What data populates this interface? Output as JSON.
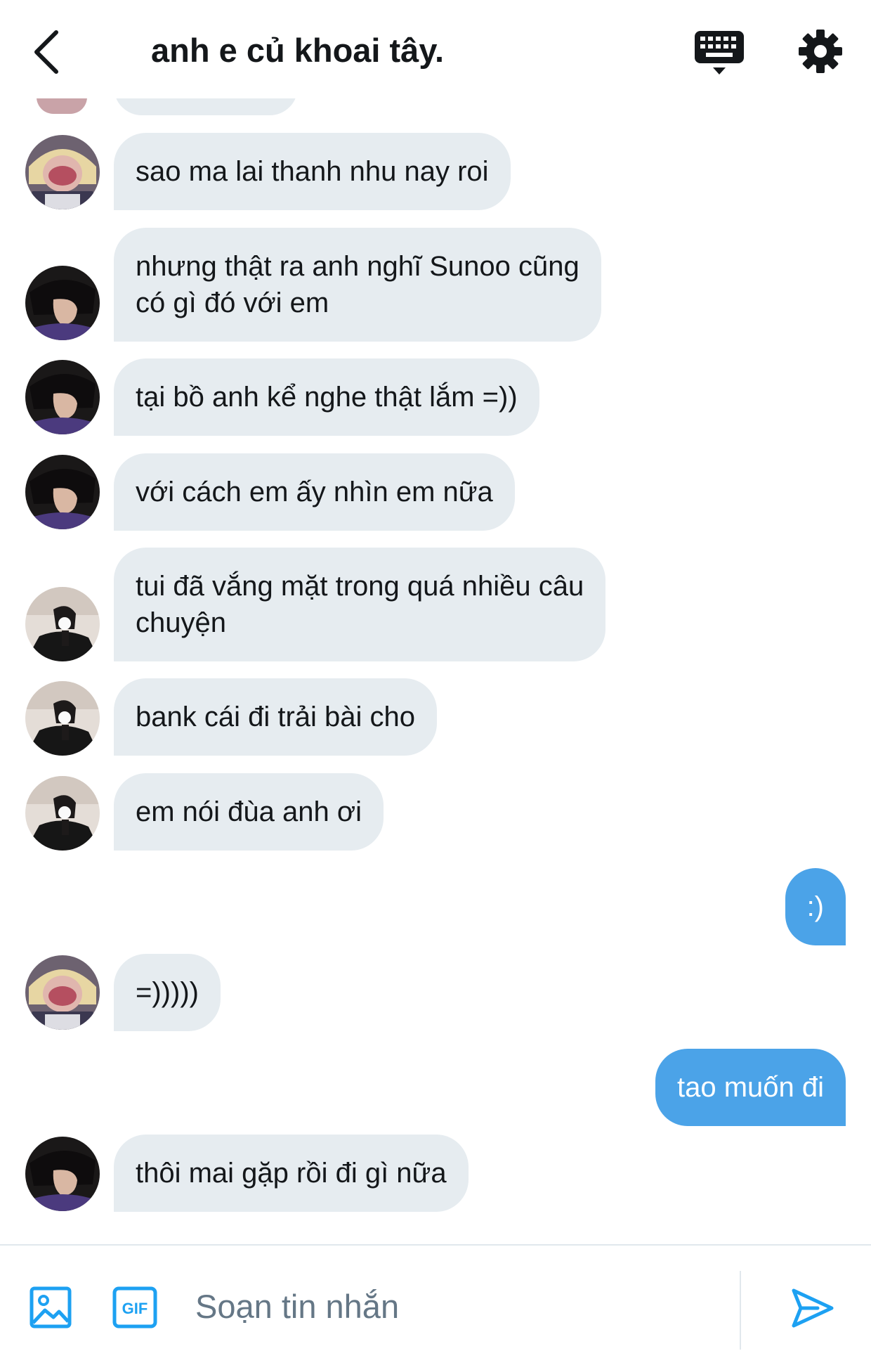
{
  "header": {
    "title": "anh e củ khoai tây."
  },
  "messages": [
    {
      "text": "sao ma lai thanh nhu nay roi",
      "avatar": "blonde-avatar"
    },
    {
      "text": "nhưng thật ra anh nghĩ Sunoo cũng\ncó gì đó với em",
      "avatar": "dark-hair-avatar"
    },
    {
      "text": "tại bồ anh kể nghe thật lắm =))",
      "avatar": "dark-hair-avatar"
    },
    {
      "text": "với cách em ấy nhìn em nữa",
      "avatar": "dark-hair-avatar"
    },
    {
      "text": "tui đã vắng mặt trong quá nhiều câu\nchuyện",
      "avatar": "mirror-selfie-avatar"
    },
    {
      "text": "bank cái đi trải bài cho",
      "avatar": "mirror-selfie-avatar"
    },
    {
      "text": "em nói đùa anh ơi",
      "avatar": "mirror-selfie-avatar"
    },
    {
      "text": ":)",
      "sent": true
    },
    {
      "text": "=)))))",
      "avatar": "blonde-avatar"
    },
    {
      "text": "tao muốn đi",
      "sent": true
    },
    {
      "text": "thôi mai gặp rồi đi gì nữa",
      "avatar": "dark-hair-avatar"
    }
  ],
  "composer": {
    "placeholder": "Soạn tin nhắn",
    "gif_label": "GIF"
  },
  "icons": {
    "back": "chevron-left-icon",
    "keyboard": "keyboard-icon",
    "settings": "gear-icon",
    "media": "image-icon",
    "gif": "gif-icon",
    "send": "send-icon"
  },
  "colors": {
    "accent": "#4ba3e8",
    "received_bubble": "#e6ecf0",
    "text": "#14171a",
    "placeholder": "#657786"
  }
}
